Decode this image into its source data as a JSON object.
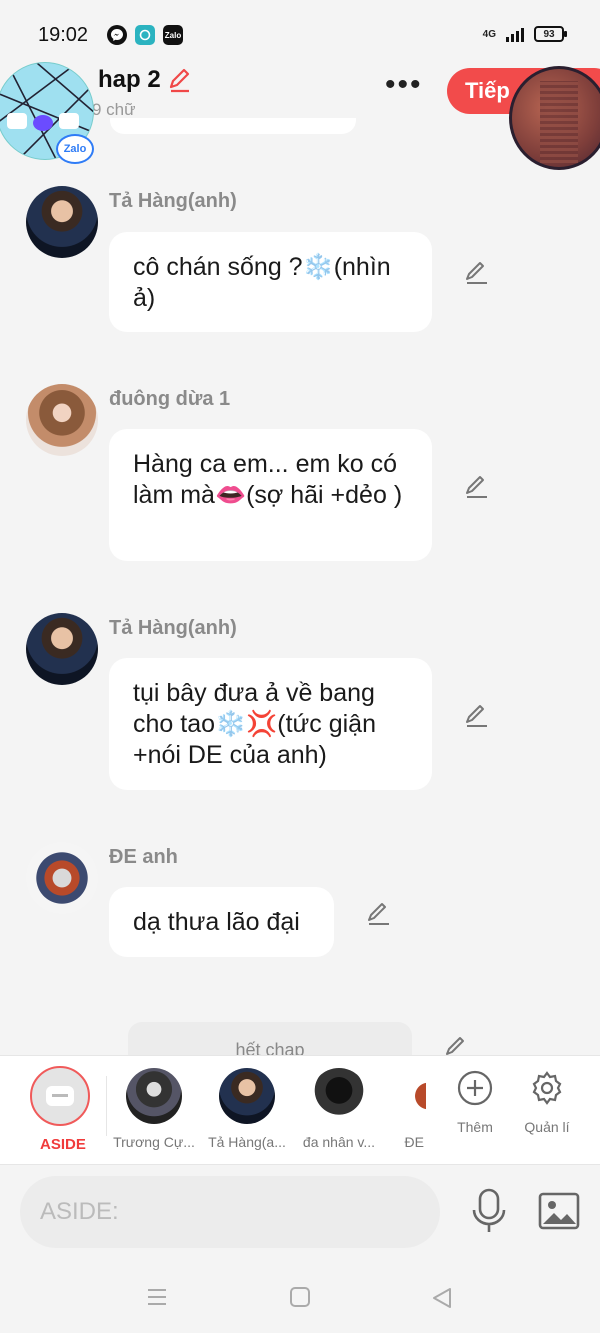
{
  "status_bar": {
    "time": "19:02",
    "apps": [
      "messenger-icon",
      "message-app-icon",
      "zalo-icon"
    ],
    "zalo_label": "Zalo",
    "network": "4G",
    "battery": "93"
  },
  "header": {
    "title": "hap 2",
    "word_count": "9 chữ",
    "more": "•••",
    "next_button": "Tiếp"
  },
  "floating": {
    "zalo_label": "Zalo"
  },
  "messages": [
    {
      "sender": "Tả Hàng(anh)",
      "text": "cô chán sống ?❄️(nhìn ả)"
    },
    {
      "sender": "đuông dừa 1",
      "text": "Hàng ca em... em ko có làm mà👄(sợ hãi +dẻo )"
    },
    {
      "sender": "Tả Hàng(anh)",
      "text": "tụi bây đưa ả về bang cho tao❄️💢(tức giận +nói DE của anh)"
    },
    {
      "sender": "ĐE anh",
      "text": "dạ thưa lão đại"
    }
  ],
  "peek_text": "hết chap",
  "character_bar": {
    "aside_label": "ASIDE",
    "characters": [
      {
        "name": "Trương Cự..."
      },
      {
        "name": "Tả Hàng(a..."
      },
      {
        "name": "đa nhân v..."
      },
      {
        "name": "ĐE"
      }
    ],
    "add_label": "Thêm",
    "manage_label": "Quản lí"
  },
  "input": {
    "placeholder": "ASIDE:"
  },
  "accent_color": "#f24b4b"
}
